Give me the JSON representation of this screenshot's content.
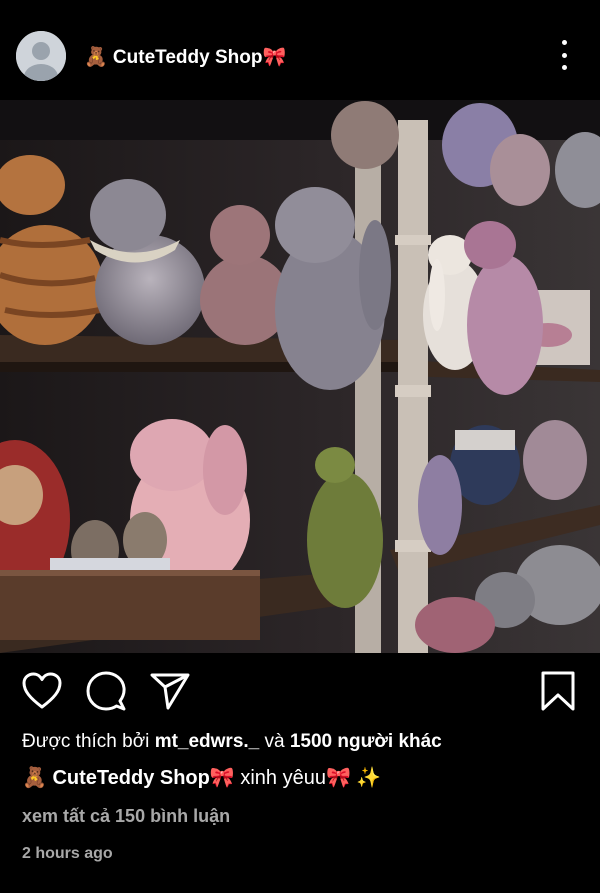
{
  "post": {
    "username": "🧸 CuteTeddy Shop🎀",
    "photo_alt": "Shelves of plush teddy bunnies and toys",
    "likes": {
      "prefix": "Được thích bởi ",
      "user": "mt_edwrs._",
      "middle": " và ",
      "others": "1500 người khác"
    },
    "caption": {
      "user": "🧸 CuteTeddy Shop🎀",
      "text": "xinh yêuu🎀 ✨"
    },
    "comments_link": "xem tất cả 150 bình luận",
    "time_ago": "2 hours ago"
  },
  "icons": {
    "more": "more-vertical-icon",
    "like": "heart-icon",
    "comment": "comment-icon",
    "share": "send-icon",
    "save": "bookmark-icon"
  },
  "colors": {
    "background": "#000000",
    "text": "#ffffff",
    "muted": "#a8a8a8"
  }
}
